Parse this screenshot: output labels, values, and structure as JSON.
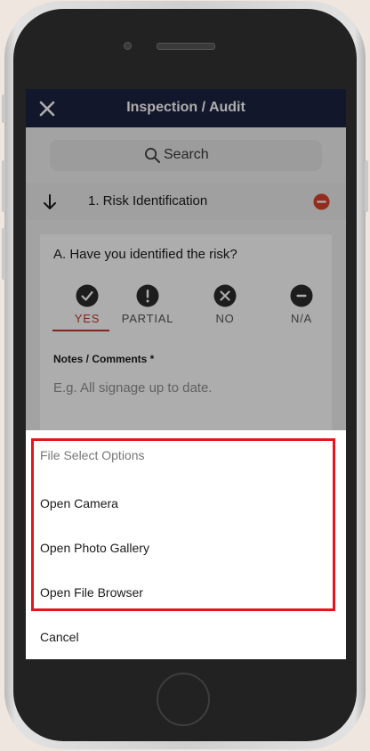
{
  "header": {
    "title": "Inspection / Audit",
    "close_icon": "close-icon"
  },
  "search": {
    "label": "Search",
    "icon": "search-icon"
  },
  "section": {
    "title": "1. Risk Identification",
    "expand_icon": "arrow-down-icon",
    "remove_icon": "remove-circle-icon",
    "remove_color": "#d9432b"
  },
  "question": {
    "text": "A. Have you identified the risk?",
    "options": [
      {
        "label": "YES",
        "icon": "check-icon",
        "selected": true
      },
      {
        "label": "PARTIAL",
        "icon": "exclamation-icon",
        "selected": false
      },
      {
        "label": "NO",
        "icon": "x-icon",
        "selected": false
      },
      {
        "label": "N/A",
        "icon": "minus-icon",
        "selected": false
      }
    ],
    "selected_color": "#c0392b",
    "notes_label": "Notes / Comments *",
    "notes_placeholder": "E.g. All signage up to date."
  },
  "file_sheet": {
    "header": "File Select Options",
    "items": [
      "Open Camera",
      "Open Photo Gallery",
      "Open File Browser"
    ],
    "cancel": "Cancel",
    "highlight_color": "#e3171b"
  },
  "colors": {
    "topbar": "#1d2240",
    "accent": "#c0392b"
  }
}
